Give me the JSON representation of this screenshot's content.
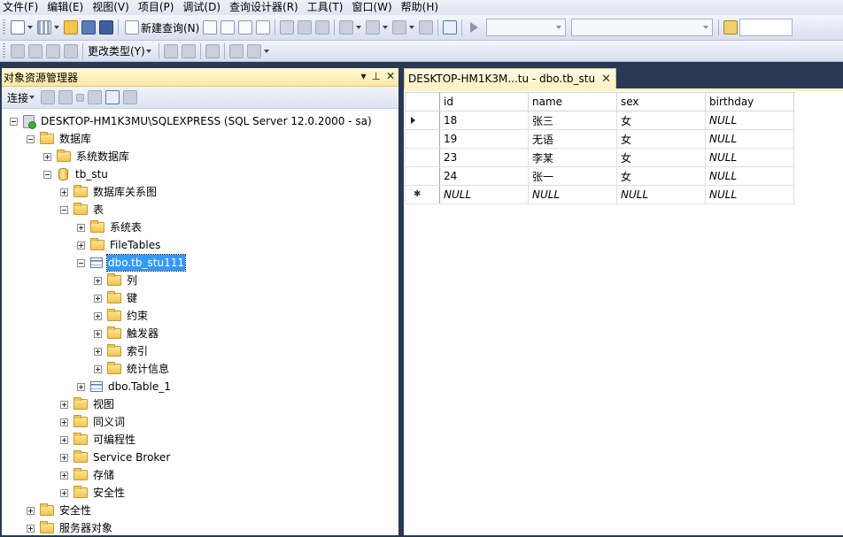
{
  "menu": [
    "文件(F)",
    "编辑(E)",
    "视图(V)",
    "项目(P)",
    "调试(D)",
    "查询设计器(R)",
    "工具(T)",
    "窗口(W)",
    "帮助(H)"
  ],
  "toolbar": {
    "new_query": "新建查询(N)",
    "change_type": "更改类型(Y)"
  },
  "explorer": {
    "title": "对象资源管理器",
    "header_buttons": [
      "▾",
      "⊥",
      "✕"
    ],
    "connect_label": "连接",
    "tree": [
      {
        "label": "DESKTOP-HM1K3MU\\SQLEXPRESS (SQL Server 12.0.2000 - sa)",
        "icon": "server-icon",
        "expander": "minus",
        "level": 0
      },
      {
        "label": "数据库",
        "icon": "folder-icon",
        "expander": "minus",
        "level": 1
      },
      {
        "label": "系统数据库",
        "icon": "folder-icon",
        "expander": "plus",
        "level": 2
      },
      {
        "label": "tb_stu",
        "icon": "database-icon",
        "expander": "minus",
        "level": 2
      },
      {
        "label": "数据库关系图",
        "icon": "folder-icon",
        "expander": "plus",
        "level": 3
      },
      {
        "label": "表",
        "icon": "folder-icon",
        "expander": "minus",
        "level": 3
      },
      {
        "label": "系统表",
        "icon": "folder-icon",
        "expander": "plus",
        "level": 4
      },
      {
        "label": "FileTables",
        "icon": "folder-icon",
        "expander": "plus",
        "level": 4
      },
      {
        "label": "dbo.tb_stu111",
        "icon": "table-icon",
        "expander": "minus",
        "level": 4,
        "selected": true
      },
      {
        "label": "列",
        "icon": "folder-icon",
        "expander": "plus",
        "level": 5
      },
      {
        "label": "键",
        "icon": "folder-icon",
        "expander": "plus",
        "level": 5
      },
      {
        "label": "约束",
        "icon": "folder-icon",
        "expander": "plus",
        "level": 5
      },
      {
        "label": "触发器",
        "icon": "folder-icon",
        "expander": "plus",
        "level": 5
      },
      {
        "label": "索引",
        "icon": "folder-icon",
        "expander": "plus",
        "level": 5
      },
      {
        "label": "统计信息",
        "icon": "folder-icon",
        "expander": "plus",
        "level": 5
      },
      {
        "label": "dbo.Table_1",
        "icon": "table-icon",
        "expander": "plus",
        "level": 4
      },
      {
        "label": "视图",
        "icon": "folder-icon",
        "expander": "plus",
        "level": 3
      },
      {
        "label": "同义词",
        "icon": "folder-icon",
        "expander": "plus",
        "level": 3
      },
      {
        "label": "可编程性",
        "icon": "folder-icon",
        "expander": "plus",
        "level": 3
      },
      {
        "label": "Service Broker",
        "icon": "folder-icon",
        "expander": "plus",
        "level": 3
      },
      {
        "label": "存储",
        "icon": "folder-icon",
        "expander": "plus",
        "level": 3
      },
      {
        "label": "安全性",
        "icon": "folder-icon",
        "expander": "plus",
        "level": 3
      },
      {
        "label": "安全性",
        "icon": "folder-icon",
        "expander": "plus",
        "level": 1
      },
      {
        "label": "服务器对象",
        "icon": "folder-icon",
        "expander": "plus",
        "level": 1
      }
    ]
  },
  "document": {
    "tab_title": "DESKTOP-HM1K3M...tu - dbo.tb_stu",
    "columns": [
      "id",
      "name",
      "sex",
      "birthday"
    ],
    "rows": [
      {
        "marker": "current",
        "cells": [
          "18",
          "张三",
          "女",
          "NULL"
        ]
      },
      {
        "marker": "",
        "cells": [
          "19",
          "无语",
          "女",
          "NULL"
        ]
      },
      {
        "marker": "",
        "cells": [
          "23",
          "李某",
          "女",
          "NULL"
        ]
      },
      {
        "marker": "",
        "cells": [
          "24",
          "张一",
          "女",
          "NULL"
        ]
      },
      {
        "marker": "new",
        "cells": [
          "NULL",
          "NULL",
          "NULL",
          "NULL"
        ]
      }
    ]
  },
  "colors": {
    "background": "#293955",
    "selection": "#3399ff",
    "panel_header": "#ffe8a6"
  }
}
